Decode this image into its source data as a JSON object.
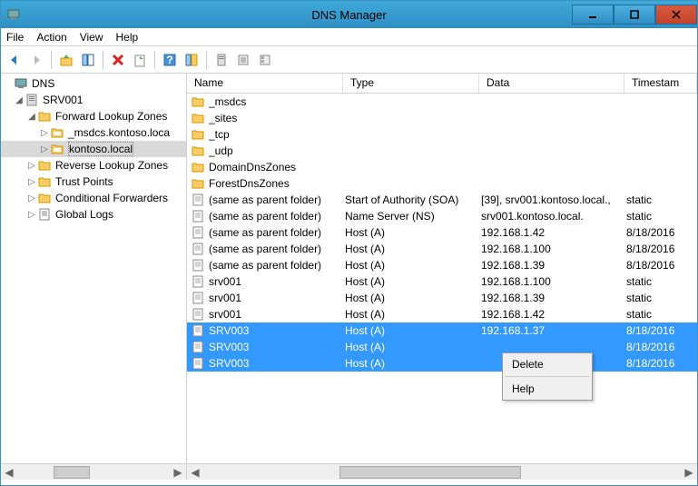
{
  "window": {
    "title": "DNS Manager"
  },
  "menu": {
    "file": "File",
    "action": "Action",
    "view": "View",
    "help": "Help"
  },
  "tree": {
    "root": "DNS",
    "server": "SRV001",
    "flz": "Forward Lookup Zones",
    "zone1": "_msdcs.kontoso.loca",
    "zone2": "kontoso.local",
    "rlz": "Reverse Lookup Zones",
    "tp": "Trust Points",
    "cf": "Conditional Forwarders",
    "gl": "Global Logs"
  },
  "columns": {
    "name": "Name",
    "type": "Type",
    "data": "Data",
    "timestamp": "Timestam"
  },
  "rows": [
    {
      "icon": "folder",
      "name": "_msdcs",
      "type": "",
      "data": "",
      "ts": "",
      "sel": false
    },
    {
      "icon": "folder",
      "name": "_sites",
      "type": "",
      "data": "",
      "ts": "",
      "sel": false
    },
    {
      "icon": "folder",
      "name": "_tcp",
      "type": "",
      "data": "",
      "ts": "",
      "sel": false
    },
    {
      "icon": "folder",
      "name": "_udp",
      "type": "",
      "data": "",
      "ts": "",
      "sel": false
    },
    {
      "icon": "folder",
      "name": "DomainDnsZones",
      "type": "",
      "data": "",
      "ts": "",
      "sel": false
    },
    {
      "icon": "folder",
      "name": "ForestDnsZones",
      "type": "",
      "data": "",
      "ts": "",
      "sel": false
    },
    {
      "icon": "record",
      "name": "(same as parent folder)",
      "type": "Start of Authority (SOA)",
      "data": "[39], srv001.kontoso.local.,",
      "ts": "static",
      "sel": false
    },
    {
      "icon": "record",
      "name": "(same as parent folder)",
      "type": "Name Server (NS)",
      "data": "srv001.kontoso.local.",
      "ts": "static",
      "sel": false
    },
    {
      "icon": "record",
      "name": "(same as parent folder)",
      "type": "Host (A)",
      "data": "192.168.1.42",
      "ts": "8/18/2016",
      "sel": false
    },
    {
      "icon": "record",
      "name": "(same as parent folder)",
      "type": "Host (A)",
      "data": "192.168.1.100",
      "ts": "8/18/2016",
      "sel": false
    },
    {
      "icon": "record",
      "name": "(same as parent folder)",
      "type": "Host (A)",
      "data": "192.168.1.39",
      "ts": "8/18/2016",
      "sel": false
    },
    {
      "icon": "record",
      "name": "srv001",
      "type": "Host (A)",
      "data": "192.168.1.100",
      "ts": "static",
      "sel": false
    },
    {
      "icon": "record",
      "name": "srv001",
      "type": "Host (A)",
      "data": "192.168.1.39",
      "ts": "static",
      "sel": false
    },
    {
      "icon": "record",
      "name": "srv001",
      "type": "Host (A)",
      "data": "192.168.1.42",
      "ts": "static",
      "sel": false
    },
    {
      "icon": "record",
      "name": "SRV003",
      "type": "Host (A)",
      "data": "192.168.1.37",
      "ts": "8/18/2016",
      "sel": true
    },
    {
      "icon": "record",
      "name": "SRV003",
      "type": "Host (A)",
      "data": "",
      "ts": "8/18/2016",
      "sel": true
    },
    {
      "icon": "record",
      "name": "SRV003",
      "type": "Host (A)",
      "data": "",
      "ts": "8/18/2016",
      "sel": true
    }
  ],
  "context": {
    "delete": "Delete",
    "help": "Help"
  }
}
